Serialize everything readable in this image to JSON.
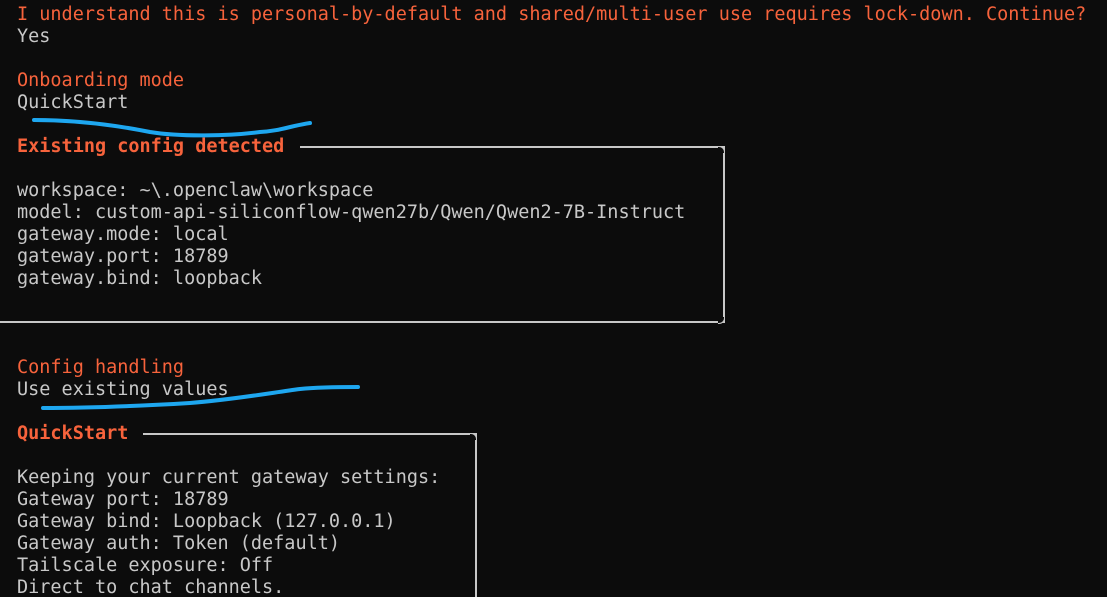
{
  "confirm": {
    "question": "I understand this is personal-by-default and shared/multi-user use requires lock-down. Continue?",
    "answer": "Yes"
  },
  "onboarding": {
    "heading": "Onboarding mode",
    "value": "QuickStart"
  },
  "existing_config": {
    "title": "Existing config detected",
    "lines": [
      "workspace: ~\\.openclaw\\workspace",
      "model: custom-api-siliconflow-qwen27b/Qwen/Qwen2-7B-Instruct",
      "gateway.mode: local",
      "gateway.port: 18789",
      "gateway.bind: loopback"
    ]
  },
  "config_handling": {
    "heading": "Config handling",
    "value": "Use existing values"
  },
  "quickstart": {
    "title": "QuickStart",
    "lines": [
      "Keeping your current gateway settings:",
      "Gateway port: 18789",
      "Gateway bind: Loopback (127.0.0.1)",
      "Gateway auth: Token (default)",
      "Tailscale exposure: Off",
      "Direct to chat channels."
    ]
  },
  "colors": {
    "background": "#0c0c0c",
    "accent": "#f7633c",
    "text": "#cccccc",
    "annotation": "#1ea7f0"
  }
}
